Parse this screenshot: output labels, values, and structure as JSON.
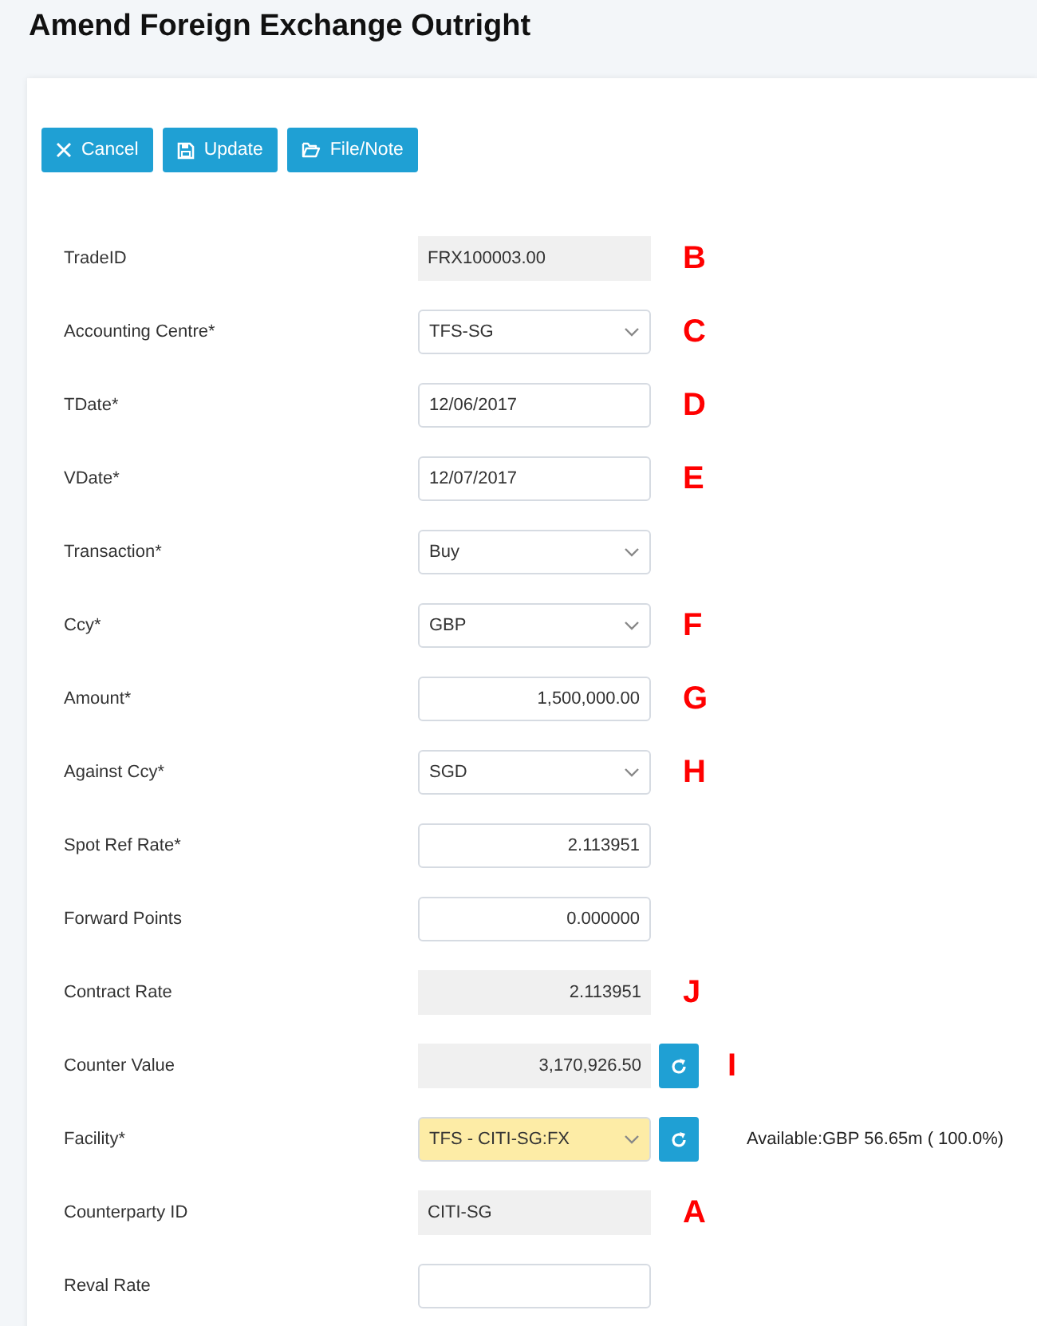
{
  "title": "Amend Foreign Exchange Outright",
  "buttons": [
    {
      "label": "Cancel"
    },
    {
      "label": "Update"
    },
    {
      "label": "File/Note"
    }
  ],
  "fields": [
    {
      "label": "TradeID",
      "kind": "readonly",
      "value": "FRX100003.00",
      "marker": "B"
    },
    {
      "label": "Accounting Centre*",
      "kind": "select",
      "value": "TFS-SG",
      "marker": "C"
    },
    {
      "label": "TDate*",
      "kind": "input",
      "value": "12/06/2017",
      "marker": "D"
    },
    {
      "label": "VDate*",
      "kind": "input",
      "value": "12/07/2017",
      "marker": "E"
    },
    {
      "label": "Transaction*",
      "kind": "select",
      "value": "Buy"
    },
    {
      "label": "Ccy*",
      "kind": "select",
      "value": "GBP",
      "marker": "F"
    },
    {
      "label": "Amount*",
      "kind": "number",
      "value": "1,500,000.00",
      "marker": "G"
    },
    {
      "label": "Against Ccy*",
      "kind": "select",
      "value": "SGD",
      "marker": "H"
    },
    {
      "label": "Spot Ref Rate*",
      "kind": "number",
      "value": "2.113951"
    },
    {
      "label": "Forward Points",
      "kind": "number",
      "value": "0.000000"
    },
    {
      "label": "Contract Rate",
      "kind": "computed",
      "value": "2.113951",
      "marker": "J"
    },
    {
      "label": "Counter Value",
      "kind": "computed",
      "value": "3,170,926.50",
      "refresh": true,
      "marker": "I"
    },
    {
      "label": "Facility*",
      "kind": "select",
      "value": "TFS - CITI-SG:FX",
      "highlighted": true,
      "refresh": true,
      "note": "Available:GBP 56.65m ( 100.0%)"
    },
    {
      "label": "Counterparty ID",
      "kind": "readonly",
      "value": "CITI-SG",
      "marker": "A"
    },
    {
      "label": "Reval Rate",
      "kind": "number"
    }
  ]
}
